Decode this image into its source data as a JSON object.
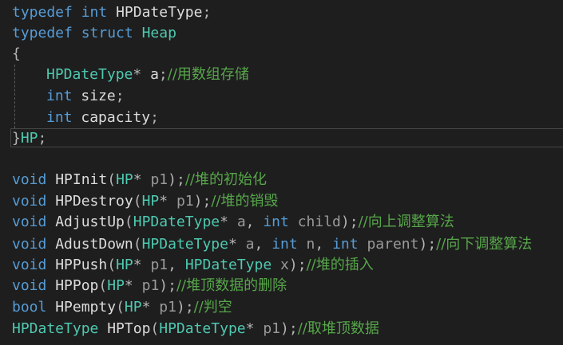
{
  "tokens": {
    "typedef": "typedef",
    "int": "int",
    "struct": "struct",
    "void": "void",
    "bool": "bool",
    "HPDateType": "HPDateType",
    "Heap": "Heap",
    "HP": "HP",
    "open_brace": "{",
    "close_brace": "}",
    "semicolon": ";",
    "star": "*",
    "lparen": "(",
    "rparen": ")",
    "comma": ",",
    "a": "a",
    "size": "size",
    "capacity": "capacity",
    "p1": "p1",
    "child": "child",
    "n": "n",
    "parent": "parent",
    "x": "x"
  },
  "functions": {
    "init": "HPInit",
    "destroy": "HPDestroy",
    "adjust_up": "AdjustUp",
    "adjust_down": "AdustDown",
    "push": "HPPush",
    "pop": "HPPop",
    "empty": "HPempty",
    "top": "HPTop"
  },
  "comments": {
    "array_storage": "//用数组存储",
    "init": "//堆的初始化",
    "destroy": "//堆的销毁",
    "adjust_up": "//向上调整算法",
    "adjust_down": "//向下调整算法",
    "push": "//堆的插入",
    "pop": "//堆顶数据的删除",
    "empty": "//判空",
    "top": "//取堆顶数据"
  },
  "colors": {
    "background": "#1e1e1e",
    "keyword": "#569cd6",
    "type": "#4ec9b0",
    "comment": "#57a64a",
    "identifier": "#dcdcdc",
    "parameter": "#9a9a9a"
  }
}
